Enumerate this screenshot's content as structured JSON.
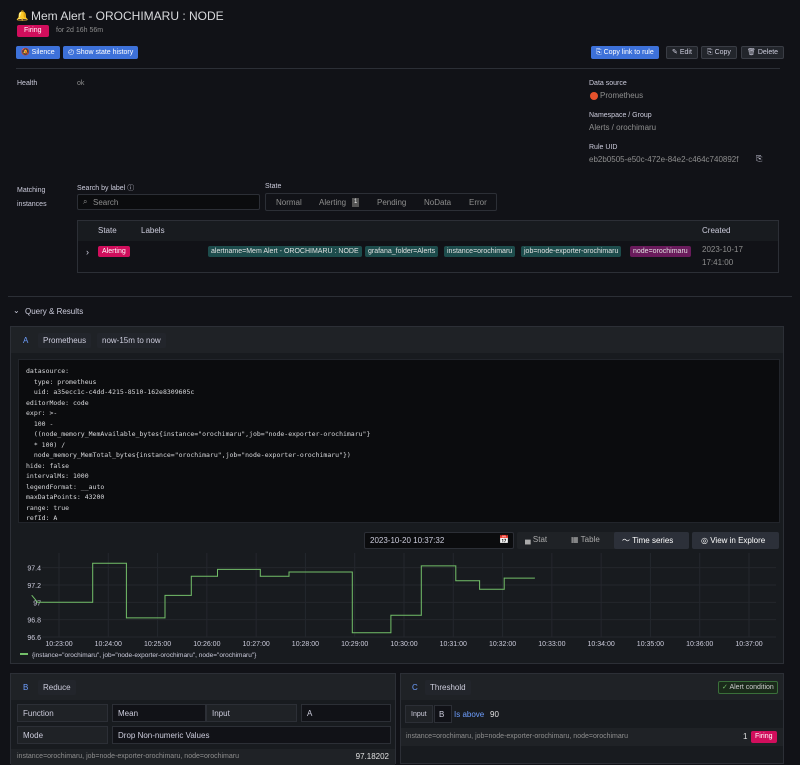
{
  "header": {
    "title": "Mem Alert - OROCHIMARU : NODE",
    "status": "Firing",
    "duration": "for 2d 16h 56m"
  },
  "actions": {
    "silence": "Silence",
    "history": "Show state history",
    "copy_link": "Copy link to rule",
    "edit": "Edit",
    "copy": "Copy",
    "delete": "Delete"
  },
  "details": {
    "health_label": "Health",
    "health_value": "ok",
    "ds_label": "Data source",
    "ds_value": "Prometheus",
    "ns_label": "Namespace / Group",
    "ns_value": "Alerts / orochimaru",
    "uid_label": "Rule UID",
    "uid_value": "eb2b0505-e50c-472e-84e2-c464c740892f"
  },
  "instances": {
    "section_label": "Matching\ninstances",
    "search_label": "Search by label",
    "search_placeholder": "Search",
    "state_label": "State",
    "filters": [
      {
        "label": "Normal"
      },
      {
        "label": "Alerting",
        "count": "1"
      },
      {
        "label": "Pending"
      },
      {
        "label": "NoData"
      },
      {
        "label": "Error"
      }
    ],
    "columns": {
      "state": "State",
      "labels": "Labels",
      "created": "Created"
    },
    "row": {
      "state": "Alerting",
      "labels": [
        "alertname=Mem Alert - OROCHIMARU : NODE",
        "grafana_folder=Alerts",
        "instance=orochimaru",
        "job=node-exporter-orochimaru",
        "node=orochimaru"
      ],
      "created_date": "2023-10-17",
      "created_time": "17:41:00"
    }
  },
  "query": {
    "section": "Query & Results",
    "ref": "A",
    "datasource": "Prometheus",
    "range": "now-15m to now",
    "code": [
      "datasource:",
      "  type: prometheus",
      "  uid: a35ecc1c-c4dd-4215-8510-162e8309605c",
      "editorMode: code",
      "expr: >-",
      "  100 -",
      "  ((node_memory_MemAvailable_bytes{instance=\"orochimaru\",job=\"node-exporter-orochimaru\"}",
      "  * 100) /",
      "  node_memory_MemTotal_bytes{instance=\"orochimaru\",job=\"node-exporter-orochimaru\"})",
      "hide: false",
      "intervalMs: 1000",
      "legendFormat: __auto",
      "maxDataPoints: 43200",
      "range: true",
      "refId: A"
    ],
    "timestamp": "2023-10-20 10:37:32",
    "views": [
      "Stat",
      "Table",
      "Time series"
    ],
    "explore": "View in Explore"
  },
  "chart_data": {
    "type": "line",
    "series": [
      {
        "name": "{instance=\"orochimaru\", job=\"node-exporter-orochimaru\", node=\"orochimaru\"}",
        "color": "#73bf69",
        "points": [
          [
            "10:22:27",
            97.08
          ],
          [
            "10:22:34",
            97.0
          ],
          [
            "10:23:41",
            97.0
          ],
          [
            "10:23:41",
            97.45
          ],
          [
            "10:24:22",
            97.45
          ],
          [
            "10:24:22",
            96.82
          ],
          [
            "10:25:09",
            96.82
          ],
          [
            "10:25:09",
            97.08
          ],
          [
            "10:25:41",
            97.08
          ],
          [
            "10:25:41",
            97.3
          ],
          [
            "10:26:13",
            97.3
          ],
          [
            "10:26:13",
            97.38
          ],
          [
            "10:27:05",
            97.38
          ],
          [
            "10:27:05",
            97.3
          ],
          [
            "10:27:40",
            97.3
          ],
          [
            "10:27:40",
            97.35
          ],
          [
            "10:28:57",
            97.35
          ],
          [
            "10:28:57",
            96.65
          ],
          [
            "10:29:44",
            96.65
          ],
          [
            "10:29:44",
            96.85
          ],
          [
            "10:30:21",
            96.85
          ],
          [
            "10:30:21",
            97.42
          ],
          [
            "10:31:03",
            97.42
          ],
          [
            "10:31:03",
            97.25
          ],
          [
            "10:31:32",
            97.25
          ],
          [
            "10:31:32",
            97.15
          ],
          [
            "10:32:02",
            97.15
          ],
          [
            "10:32:02",
            97.28
          ],
          [
            "10:32:39",
            97.28
          ]
        ]
      }
    ],
    "y_ticks": [
      "97.4",
      "97.2",
      "97",
      "96.8",
      "96.6"
    ],
    "x_ticks": [
      "10:23:00",
      "10:24:00",
      "10:25:00",
      "10:26:00",
      "10:27:00",
      "10:28:00",
      "10:29:00",
      "10:30:00",
      "10:31:00",
      "10:32:00",
      "10:33:00",
      "10:34:00",
      "10:35:00",
      "10:36:00",
      "10:37:00"
    ],
    "ylim": [
      96.6,
      97.5
    ]
  },
  "reduce": {
    "ref": "B",
    "title": "Reduce",
    "function_label": "Function",
    "function_value": "Mean",
    "input_label": "Input",
    "input_value": "A",
    "mode_label": "Mode",
    "mode_value": "Drop Non-numeric Values",
    "result_labels": "instance=orochimaru, job=node-exporter-orochimaru, node=orochimaru",
    "result_value": "97.18202"
  },
  "threshold": {
    "ref": "C",
    "title": "Threshold",
    "condition": "Alert condition",
    "input_label": "Input",
    "input_value": "B",
    "op": "Is above",
    "value": "90",
    "result_labels": "instance=orochimaru, job=node-exporter-orochimaru, node=orochimaru",
    "result_value": "1",
    "result_state": "Firing"
  },
  "colors": {
    "firing": "#d10e5c",
    "accent": "#3d71d9",
    "series": "#73bf69",
    "label_tag": "#1d4c4c",
    "node_tag": "#6a1b5c"
  }
}
